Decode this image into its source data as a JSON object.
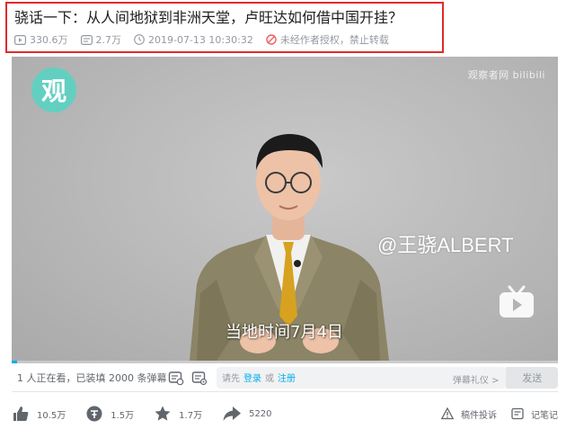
{
  "video": {
    "title": "骁话一下：从人间地狱到非洲天堂，卢旺达如何借中国开挂？",
    "views": "330.6万",
    "danmaku": "2.7万",
    "published": "2019-07-13 10:30:32",
    "copyright_notice": "未经作者授权，禁止转载"
  },
  "player": {
    "logo_text": "观",
    "watermark": "观察者网 bilibili",
    "handle_overlay": "@王骁ALBERT",
    "subtitle": "当地时间7月4日",
    "progress_fraction": 0.01
  },
  "danmaku_bar": {
    "watching_text": "1 人正在看，已装填 2000 条弹幕",
    "input_prefix": "请先",
    "login_link": "登录",
    "or_text": "或",
    "register_link": "注册",
    "etiquette_label": "弹幕礼仪 >",
    "send_label": "发送"
  },
  "toolbar": {
    "like_count": "10.5万",
    "coin_count": "1.5万",
    "favorite_count": "1.7万",
    "share_count": "5220",
    "report_label": "稿件投诉",
    "notes_label": "记笔记"
  },
  "colors": {
    "accent": "#00aeec",
    "highlight_border": "#e02a2a",
    "logo_teal": "#63cfc1"
  }
}
